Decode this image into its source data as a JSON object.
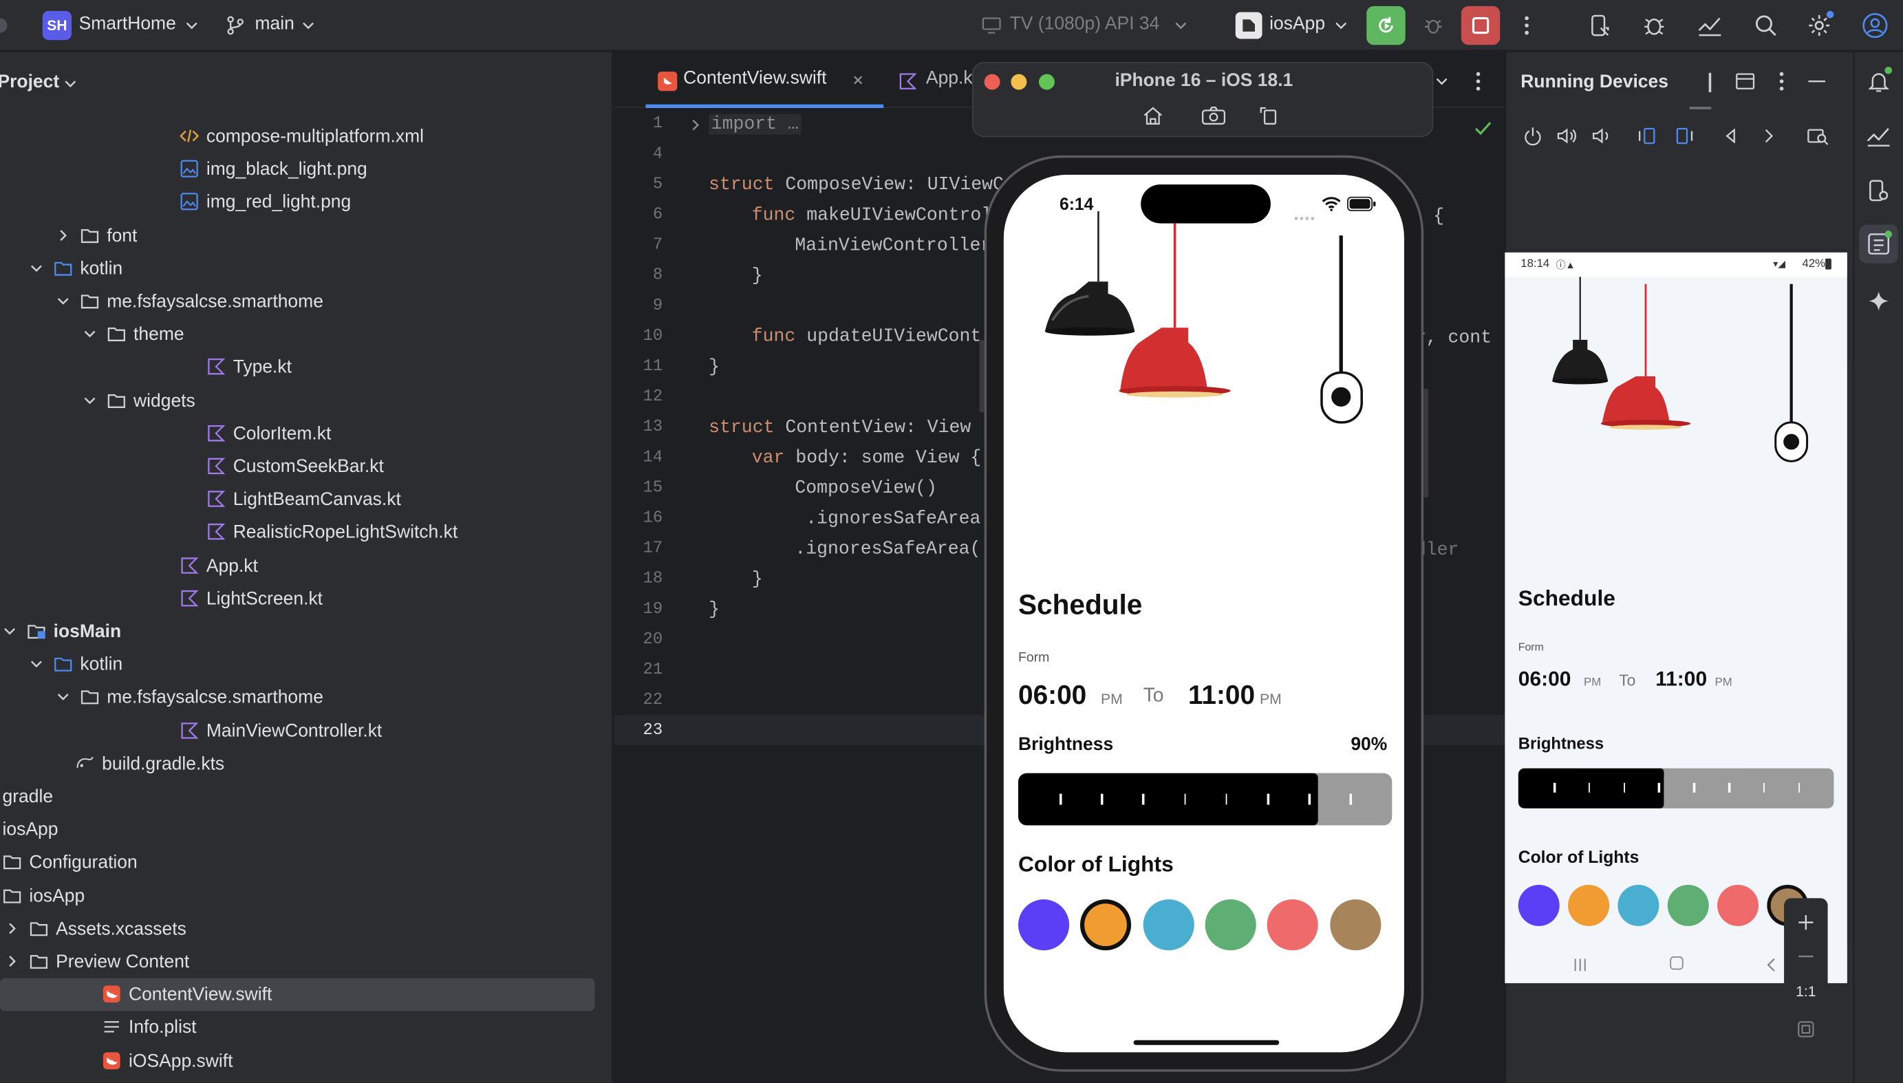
{
  "toolbar": {
    "project_badge": "SH",
    "project_name": "SmartHome",
    "branch": "main",
    "device": "TV (1080p) API 34",
    "run_config": "iosApp"
  },
  "project_panel": {
    "title": "Project",
    "rows": [
      {
        "label": "compose-multiplatform.xml",
        "icon": "xml-file-icon"
      },
      {
        "label": "img_black_light.png",
        "icon": "image-file-icon"
      },
      {
        "label": "img_red_light.png",
        "icon": "image-file-icon"
      },
      {
        "label": "font",
        "icon": "folder-icon"
      },
      {
        "label": "kotlin",
        "icon": "source-folder-icon"
      },
      {
        "label": "me.fsfaysalcse.smarthome",
        "icon": "package-icon"
      },
      {
        "label": "theme",
        "icon": "package-icon"
      },
      {
        "label": "Type.kt",
        "icon": "kotlin-file-icon"
      },
      {
        "label": "widgets",
        "icon": "package-icon"
      },
      {
        "label": "ColorItem.kt",
        "icon": "kotlin-file-icon"
      },
      {
        "label": "CustomSeekBar.kt",
        "icon": "kotlin-file-icon"
      },
      {
        "label": "LightBeamCanvas.kt",
        "icon": "kotlin-file-icon"
      },
      {
        "label": "RealisticRopeLightSwitch.kt",
        "icon": "kotlin-file-icon"
      },
      {
        "label": "App.kt",
        "icon": "kotlin-file-icon"
      },
      {
        "label": "LightScreen.kt",
        "icon": "kotlin-file-icon"
      },
      {
        "label": "iosMain",
        "icon": "module-folder-icon"
      },
      {
        "label": "kotlin",
        "icon": "source-folder-icon"
      },
      {
        "label": "me.fsfaysalcse.smarthome",
        "icon": "package-icon"
      },
      {
        "label": "MainViewController.kt",
        "icon": "kotlin-file-icon"
      },
      {
        "label": "build.gradle.kts",
        "icon": "gradle-file-icon"
      },
      {
        "label": "gradle",
        "icon": "folder-icon"
      },
      {
        "label": "iosApp",
        "icon": "folder-icon"
      },
      {
        "label": "Configuration",
        "icon": "folder-icon"
      },
      {
        "label": "iosApp",
        "icon": "folder-icon"
      },
      {
        "label": "Assets.xcassets",
        "icon": "folder-icon"
      },
      {
        "label": "Preview Content",
        "icon": "folder-icon"
      },
      {
        "label": "ContentView.swift",
        "icon": "swift-file-icon"
      },
      {
        "label": "Info.plist",
        "icon": "plist-file-icon"
      },
      {
        "label": "iOSApp.swift",
        "icon": "swift-file-icon"
      }
    ]
  },
  "editor": {
    "tabs": [
      {
        "label": "ContentView.swift"
      },
      {
        "label": "App.k"
      }
    ],
    "line_numbers": [
      "1",
      "4",
      "5",
      "6",
      "7",
      "8",
      "9",
      "10",
      "11",
      "12",
      "13",
      "14",
      "15",
      "16",
      "17",
      "18",
      "19",
      "20",
      "21",
      "22",
      "23"
    ],
    "code_lines": [
      {
        "kw": "",
        "text": "import …"
      },
      {
        "kw": "",
        "text": ""
      },
      {
        "kw": "struct",
        "text": " ComposeView: UIViewC"
      },
      {
        "kw": "func",
        "text": " makeUIViewControl"
      },
      {
        "kw": "",
        "text": "MainViewController"
      },
      {
        "kw": "",
        "text": "}"
      },
      {
        "kw": "",
        "text": ""
      },
      {
        "kw": "func",
        "text": " updateUIViewCont"
      },
      {
        "kw": "",
        "text": "}"
      },
      {
        "kw": "",
        "text": ""
      },
      {
        "kw": "struct",
        "text": " ContentView: View"
      },
      {
        "kw": "var",
        "text": " body: some View {"
      },
      {
        "kw": "",
        "text": "ComposeView()"
      },
      {
        "kw": "",
        "text": " .ignoresSafeArea"
      },
      {
        "kw": "",
        "text": ".ignoresSafeArea(."
      },
      {
        "kw": "",
        "text": "}"
      },
      {
        "kw": "",
        "text": "}"
      }
    ],
    "overflow_right": {
      "line6": "{",
      "line10": "r, cont",
      "line17": "dler"
    }
  },
  "simulator": {
    "title": "iPhone 16 – iOS 18.1",
    "status_time": "6:14"
  },
  "app": {
    "schedule_title": "Schedule",
    "form_label": "Form",
    "from_time": "06:00",
    "from_suffix": "PM",
    "to_label": "To",
    "to_time": "11:00",
    "to_suffix": "PM",
    "brightness_label": "Brightness",
    "brightness_value": "90%",
    "colors_title": "Color of Lights",
    "swatches": [
      "#5b3ff6",
      "#f09c30",
      "#4aaed0",
      "#5fae74",
      "#ef6b6b",
      "#a8845a"
    ]
  },
  "running_devices": {
    "title": "Running Devices",
    "status_time": "18:14",
    "battery": "42%",
    "brightness_fraction": 0.45,
    "zoom_label": "1:1"
  },
  "phone_brightness_fraction": 0.9,
  "colors": {
    "accent_green": "#5fb85f",
    "stop_red": "#c94f4f",
    "lamp_red": "#d23030",
    "lamp_black": "#1a1a1a"
  }
}
